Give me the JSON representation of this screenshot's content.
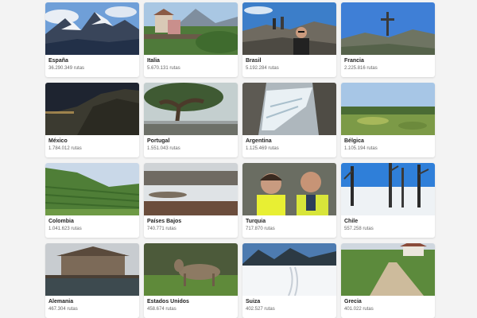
{
  "countries": [
    {
      "name": "España",
      "routes": "36.290.349 rutas",
      "photo": "snowy-mountains"
    },
    {
      "name": "Italia",
      "routes": "5.670.131 rutas",
      "photo": "mountain-village"
    },
    {
      "name": "Brasil",
      "routes": "5.192.284 rutas",
      "photo": "hikers-summit"
    },
    {
      "name": "Francia",
      "routes": "2.225.816 rutas",
      "photo": "summit-cross"
    },
    {
      "name": "México",
      "routes": "1.784.012 rutas",
      "photo": "night-cliff"
    },
    {
      "name": "Portugal",
      "routes": "1.551.043 rutas",
      "photo": "tree-terrace"
    },
    {
      "name": "Argentina",
      "routes": "1.125.469 rutas",
      "photo": "glacier"
    },
    {
      "name": "Bélgica",
      "routes": "1.105.194 rutas",
      "photo": "green-valley"
    },
    {
      "name": "Colombia",
      "routes": "1.041.623 rutas",
      "photo": "vineyard-hills"
    },
    {
      "name": "Países Bajos",
      "routes": "740.771 rutas",
      "photo": "wetland"
    },
    {
      "name": "Turquia",
      "routes": "717.870 rutas",
      "photo": "couple-selfie"
    },
    {
      "name": "Chile",
      "routes": "557.258 rutas",
      "photo": "snowy-forest"
    },
    {
      "name": "Alemania",
      "routes": "467.304 rutas",
      "photo": "building-boardwalk"
    },
    {
      "name": "Estados Unidos",
      "routes": "458.674 rutas",
      "photo": "deer"
    },
    {
      "name": "Suiza",
      "routes": "402.527 rutas",
      "photo": "snow-tracks"
    },
    {
      "name": "Grecia",
      "routes": "401.022 rutas",
      "photo": "dirt-road"
    }
  ]
}
